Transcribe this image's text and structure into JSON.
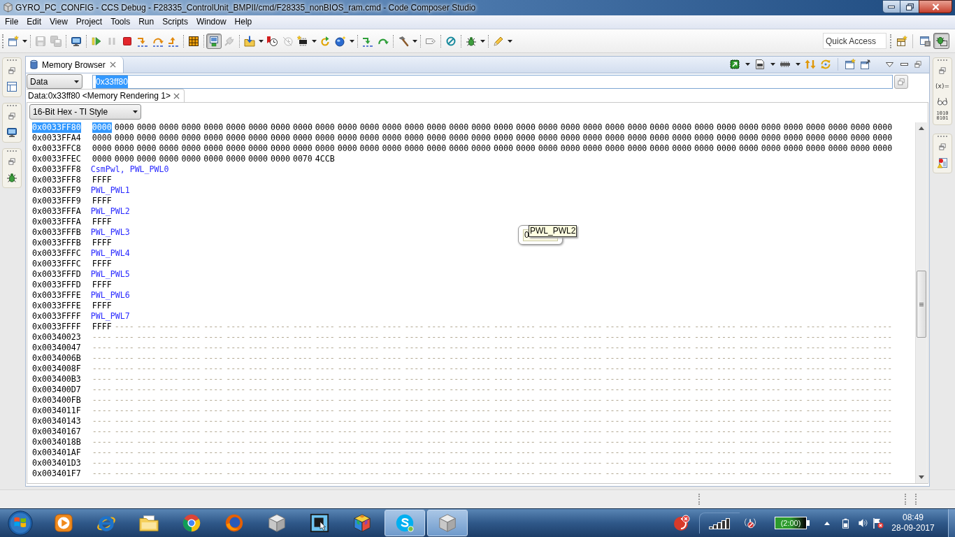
{
  "window": {
    "title": "GYRO_PC_CONFIG - CCS Debug - F28335_ControlUnit_BMPII/cmd/F28335_nonBIOS_ram.cmd - Code Composer Studio"
  },
  "menu": [
    "File",
    "Edit",
    "View",
    "Project",
    "Tools",
    "Run",
    "Scripts",
    "Window",
    "Help"
  ],
  "toolbar": {
    "groups": [
      {
        "buttons": [
          {
            "kind": "new",
            "disabled": false,
            "pressed": false,
            "menu": true
          }
        ]
      },
      {
        "buttons": [
          {
            "kind": "save",
            "disabled": true,
            "pressed": false,
            "menu": false
          },
          {
            "kind": "save-all",
            "disabled": true,
            "pressed": false,
            "menu": false
          }
        ]
      },
      {
        "buttons": [
          {
            "kind": "monitor",
            "disabled": false,
            "pressed": false,
            "menu": false
          }
        ]
      },
      {
        "buttons": [
          {
            "kind": "resume",
            "disabled": false,
            "pressed": false,
            "menu": false
          },
          {
            "kind": "suspend",
            "disabled": true,
            "pressed": false,
            "menu": false
          },
          {
            "kind": "terminate",
            "disabled": false,
            "pressed": false,
            "menu": false
          },
          {
            "kind": "step-into",
            "disabled": false,
            "pressed": false,
            "menu": false
          },
          {
            "kind": "step-over",
            "disabled": false,
            "pressed": false,
            "menu": false
          },
          {
            "kind": "step-return",
            "disabled": false,
            "pressed": false,
            "menu": false
          }
        ]
      },
      {
        "buttons": [
          {
            "kind": "grid",
            "disabled": false,
            "pressed": false,
            "menu": false
          }
        ]
      },
      {
        "buttons": [
          {
            "kind": "connect",
            "disabled": false,
            "pressed": true,
            "menu": false
          },
          {
            "kind": "disconnect",
            "disabled": true,
            "pressed": false,
            "menu": false
          }
        ]
      },
      {
        "buttons": [
          {
            "kind": "load",
            "disabled": false,
            "pressed": false,
            "menu": true
          },
          {
            "kind": "breakpoint",
            "disabled": false,
            "pressed": false,
            "menu": false
          },
          {
            "kind": "breakpoint-off",
            "disabled": true,
            "pressed": false,
            "menu": false
          },
          {
            "kind": "chip",
            "disabled": false,
            "pressed": false,
            "menu": true
          },
          {
            "kind": "restart",
            "disabled": false,
            "pressed": false,
            "menu": false
          },
          {
            "kind": "globe",
            "disabled": false,
            "pressed": false,
            "menu": true
          }
        ]
      },
      {
        "buttons": [
          {
            "kind": "asm-step-into",
            "disabled": false,
            "pressed": false,
            "menu": false
          },
          {
            "kind": "asm-step-over",
            "disabled": false,
            "pressed": false,
            "menu": false
          }
        ]
      },
      {
        "buttons": [
          {
            "kind": "hammer",
            "disabled": false,
            "pressed": false,
            "menu": true
          }
        ]
      },
      {
        "buttons": [
          {
            "kind": "tag",
            "disabled": false,
            "pressed": false,
            "menu": false
          }
        ]
      },
      {
        "buttons": [
          {
            "kind": "circle-slash",
            "disabled": false,
            "pressed": false,
            "menu": false
          }
        ]
      },
      {
        "buttons": [
          {
            "kind": "bug",
            "disabled": false,
            "pressed": false,
            "menu": true
          }
        ]
      },
      {
        "buttons": [
          {
            "kind": "pen",
            "disabled": false,
            "pressed": false,
            "menu": true
          }
        ]
      }
    ]
  },
  "quick_access": {
    "placeholder": "Quick Access"
  },
  "perspectives": [
    {
      "kind": "edit",
      "selected": false
    },
    {
      "kind": "debug",
      "selected": true
    }
  ],
  "right_trim": {
    "variables_glyph": "(x)=",
    "registers_glyph": [
      "1010",
      "0101"
    ]
  },
  "memory_browser": {
    "title": "Memory Browser",
    "memory_space": "Data",
    "address": {
      "value": "0x33ff80",
      "selected": true
    },
    "rendering_tab": "Data:0x33ff80 <Memory Rendering 1>",
    "format": "16-Bit Hex - TI Style",
    "rows": [
      {
        "kind": "hex",
        "address": "0x0033FF80",
        "selected": true,
        "cursor_value": "0000",
        "values": "0000 0000 0000 0000 0000 0000 0000 0000 0000 0000 0000 0000 0000 0000 0000 0000 0000 0000 0000 0000 0000 0000 0000 0000 0000 0000 0000 0000 0000 0000 0000 0000 0000 0000 0000"
      },
      {
        "kind": "hex",
        "address": "0x0033FFA4",
        "selected": false,
        "values": "0000 0000 0000 0000 0000 0000 0000 0000 0000 0000 0000 0000 0000 0000 0000 0000 0000 0000 0000 0000 0000 0000 0000 0000 0000 0000 0000 0000 0000 0000 0000 0000 0000 0000 0000 0000"
      },
      {
        "kind": "hex",
        "address": "0x0033FFC8",
        "selected": false,
        "values": "0000 0000 0000 0000 0000 0000 0000 0000 0000 0000 0000 0000 0000 0000 0000 0000 0000 0000 0000 0000 0000 0000 0000 0000 0000 0000 0000 0000 0000 0000 0000 0000 0000 0000 0000 0000"
      },
      {
        "kind": "hex",
        "address": "0x0033FFEC",
        "selected": false,
        "values": "0000 0000 0000 0000 0000 0000 0000 0000 0000 0070 4CCB"
      },
      {
        "kind": "symbol",
        "address": "0x0033FFF8",
        "selected": false,
        "symbols": "CsmPwl, PWL_PWL0"
      },
      {
        "kind": "hex",
        "address": "0x0033FFF8",
        "selected": false,
        "values": "FFFF"
      },
      {
        "kind": "symbol",
        "address": "0x0033FFF9",
        "selected": false,
        "symbols": "PWL_PWL1"
      },
      {
        "kind": "hex",
        "address": "0x0033FFF9",
        "selected": false,
        "values": "FFFF"
      },
      {
        "kind": "symbol",
        "address": "0x0033FFFA",
        "selected": false,
        "symbols": "PWL_PWL2"
      },
      {
        "kind": "hex",
        "address": "0x0033FFFA",
        "selected": false,
        "values": "FFFF"
      },
      {
        "kind": "symbol",
        "address": "0x0033FFFB",
        "selected": false,
        "symbols": "PWL_PWL3"
      },
      {
        "kind": "hex",
        "address": "0x0033FFFB",
        "selected": false,
        "values": "FFFF"
      },
      {
        "kind": "symbol",
        "address": "0x0033FFFC",
        "selected": false,
        "symbols": "PWL_PWL4"
      },
      {
        "kind": "hex",
        "address": "0x0033FFFC",
        "selected": false,
        "values": "FFFF"
      },
      {
        "kind": "symbol",
        "address": "0x0033FFFD",
        "selected": false,
        "symbols": "PWL_PWL5"
      },
      {
        "kind": "hex",
        "address": "0x0033FFFD",
        "selected": false,
        "values": "FFFF"
      },
      {
        "kind": "symbol",
        "address": "0x0033FFFE",
        "selected": false,
        "symbols": "PWL_PWL6"
      },
      {
        "kind": "hex",
        "address": "0x0033FFFE",
        "selected": false,
        "values": "FFFF"
      },
      {
        "kind": "symbol",
        "address": "0x0033FFFF",
        "selected": false,
        "symbols": "PWL_PWL7"
      },
      {
        "kind": "hex",
        "address": "0x0033FFFF",
        "selected": false,
        "values": "FFFF",
        "unreadable": "---- ---- ---- ---- ---- ---- ---- ---- ---- ---- ---- ---- ---- ---- ---- ---- ---- ---- ---- ---- ---- ---- ---- ---- ---- ---- ---- ---- ---- ---- ---- ---- ---- ---- ----"
      },
      {
        "kind": "hex",
        "address": "0x00340023",
        "selected": false,
        "unreadable": "---- ---- ---- ---- ---- ---- ---- ---- ---- ---- ---- ---- ---- ---- ---- ---- ---- ---- ---- ---- ---- ---- ---- ---- ---- ---- ---- ---- ---- ---- ---- ---- ---- ---- ---- ----"
      },
      {
        "kind": "hex",
        "address": "0x00340047",
        "selected": false,
        "unreadable": "---- ---- ---- ---- ---- ---- ---- ---- ---- ---- ---- ---- ---- ---- ---- ---- ---- ---- ---- ---- ---- ---- ---- ---- ---- ---- ---- ---- ---- ---- ---- ---- ---- ---- ---- ----"
      },
      {
        "kind": "hex",
        "address": "0x0034006B",
        "selected": false,
        "unreadable": "---- ---- ---- ---- ---- ---- ---- ---- ---- ---- ---- ---- ---- ---- ---- ---- ---- ---- ---- ---- ---- ---- ---- ---- ---- ---- ---- ---- ---- ---- ---- ---- ---- ---- ---- ----"
      },
      {
        "kind": "hex",
        "address": "0x0034008F",
        "selected": false,
        "unreadable": "---- ---- ---- ---- ---- ---- ---- ---- ---- ---- ---- ---- ---- ---- ---- ---- ---- ---- ---- ---- ---- ---- ---- ---- ---- ---- ---- ---- ---- ---- ---- ---- ---- ---- ---- ----"
      },
      {
        "kind": "hex",
        "address": "0x003400B3",
        "selected": false,
        "unreadable": "---- ---- ---- ---- ---- ---- ---- ---- ---- ---- ---- ---- ---- ---- ---- ---- ---- ---- ---- ---- ---- ---- ---- ---- ---- ---- ---- ---- ---- ---- ---- ---- ---- ---- ---- ----"
      },
      {
        "kind": "hex",
        "address": "0x003400D7",
        "selected": false,
        "unreadable": "---- ---- ---- ---- ---- ---- ---- ---- ---- ---- ---- ---- ---- ---- ---- ---- ---- ---- ---- ---- ---- ---- ---- ---- ---- ---- ---- ---- ---- ---- ---- ---- ---- ---- ---- ----"
      },
      {
        "kind": "hex",
        "address": "0x003400FB",
        "selected": false,
        "unreadable": "---- ---- ---- ---- ---- ---- ---- ---- ---- ---- ---- ---- ---- ---- ---- ---- ---- ---- ---- ---- ---- ---- ---- ---- ---- ---- ---- ---- ---- ---- ---- ---- ---- ---- ---- ----"
      },
      {
        "kind": "hex",
        "address": "0x0034011F",
        "selected": false,
        "unreadable": "---- ---- ---- ---- ---- ---- ---- ---- ---- ---- ---- ---- ---- ---- ---- ---- ---- ---- ---- ---- ---- ---- ---- ---- ---- ---- ---- ---- ---- ---- ---- ---- ---- ---- ---- ----"
      },
      {
        "kind": "hex",
        "address": "0x00340143",
        "selected": false,
        "unreadable": "---- ---- ---- ---- ---- ---- ---- ---- ---- ---- ---- ---- ---- ---- ---- ---- ---- ---- ---- ---- ---- ---- ---- ---- ---- ---- ---- ---- ---- ---- ---- ---- ---- ---- ---- ----"
      },
      {
        "kind": "hex",
        "address": "0x00340167",
        "selected": false,
        "unreadable": "---- ---- ---- ---- ---- ---- ---- ---- ---- ---- ---- ---- ---- ---- ---- ---- ---- ---- ---- ---- ---- ---- ---- ---- ---- ---- ---- ---- ---- ---- ---- ---- ---- ---- ---- ----"
      },
      {
        "kind": "hex",
        "address": "0x0034018B",
        "selected": false,
        "unreadable": "---- ---- ---- ---- ---- ---- ---- ---- ---- ---- ---- ---- ---- ---- ---- ---- ---- ---- ---- ---- ---- ---- ---- ---- ---- ---- ---- ---- ---- ---- ---- ---- ---- ---- ---- ----"
      },
      {
        "kind": "hex",
        "address": "0x003401AF",
        "selected": false,
        "unreadable": "---- ---- ---- ---- ---- ---- ---- ---- ---- ---- ---- ---- ---- ---- ---- ---- ---- ---- ---- ---- ---- ---- ---- ---- ---- ---- ---- ---- ---- ---- ---- ---- ---- ---- ---- ----"
      },
      {
        "kind": "hex",
        "address": "0x003401D3",
        "selected": false,
        "unreadable": "---- ---- ---- ---- ---- ---- ---- ---- ---- ---- ---- ---- ---- ---- ---- ---- ---- ---- ---- ---- ---- ---- ---- ---- ---- ---- ---- ---- ---- ---- ---- ---- ---- ---- ---- ----"
      },
      {
        "kind": "hex",
        "address": "0x003401F7",
        "selected": false,
        "unreadable": "---- ---- ---- ---- ---- ---- ---- ---- ---- ---- ---- ---- ---- ---- ---- ---- ---- ---- ---- ---- ---- ---- ---- ---- ---- ---- ---- ---- ---- ---- ---- ---- ---- ---- ---- ----"
      }
    ],
    "hover_popup": {
      "value": "0"
    },
    "tooltip": "PWL_PWL2"
  },
  "taskbar": {
    "apps": [
      {
        "kind": "media-player",
        "open": false
      },
      {
        "kind": "ie",
        "open": false
      },
      {
        "kind": "explorer",
        "open": false
      },
      {
        "kind": "chrome",
        "open": false
      },
      {
        "kind": "firefox",
        "open": false
      },
      {
        "kind": "cube",
        "open": false
      },
      {
        "kind": "chip-app",
        "open": false
      },
      {
        "kind": "rubik",
        "open": false
      },
      {
        "kind": "skype",
        "open": true
      },
      {
        "kind": "cube",
        "open": true
      }
    ],
    "tray": {
      "battery_time": "(2:00)",
      "time": "08:49",
      "date": "28-09-2017"
    }
  }
}
